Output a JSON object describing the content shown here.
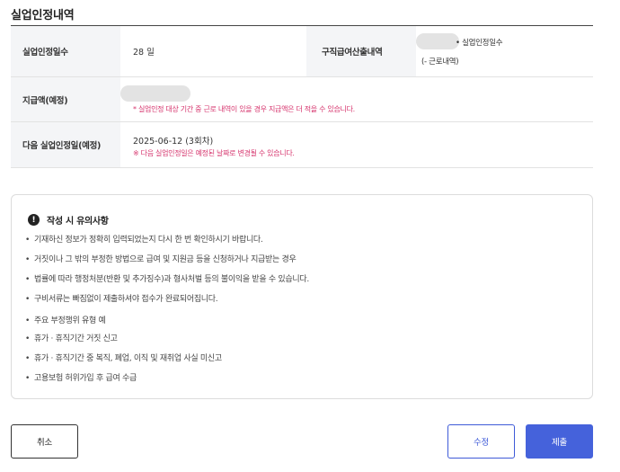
{
  "page_title": "실업인정내역",
  "table": {
    "row1": {
      "label1": "실업인정일수",
      "value1": "28 일",
      "label2": "구직급여산출내역",
      "note_line1": "• 실업인정일수",
      "note_line2": "(- 근로내역)"
    },
    "row2": {
      "label": "지급액(예정)",
      "warning": "* 실업인정 대상 기간 중 근로 내역이 있을 경우 지급액은 더 적을 수 있습니다."
    },
    "row3": {
      "label": "다음 실업인정일(예정)",
      "date": "2025-06-12 (3회차)",
      "warning": "※ 다음 실업인정일은 예정된 날짜로 변경될 수 있습니다."
    }
  },
  "notice": {
    "icon": "exclamation-circle-icon",
    "title": "작성 시 유의사항",
    "items": [
      "기재하신 정보가 정확히 입력되었는지 다시 한 번 확인하시기 바랍니다.",
      "거짓이나 그 밖의 부정한 방법으로 급여 및 지원금 등을 신청하거나 지급받는 경우",
      "법률에 따라 행정처분(반환 및 추가징수)과 형사처벌 등의 불이익을 받을 수 있습니다.",
      "구비서류는 빠짐없이 제출하셔야 접수가 완료되어집니다.",
      "주요 부정행위 유형 예",
      "휴가 · 휴직기간 거짓 신고",
      "휴가 · 휴직기간 중 복직, 폐업, 이직 및 재취업 사실 미신고",
      "고용보험 허위가입 후 급여 수급"
    ]
  },
  "buttons": {
    "cancel": "취소",
    "edit": "수정",
    "submit": "제출"
  }
}
